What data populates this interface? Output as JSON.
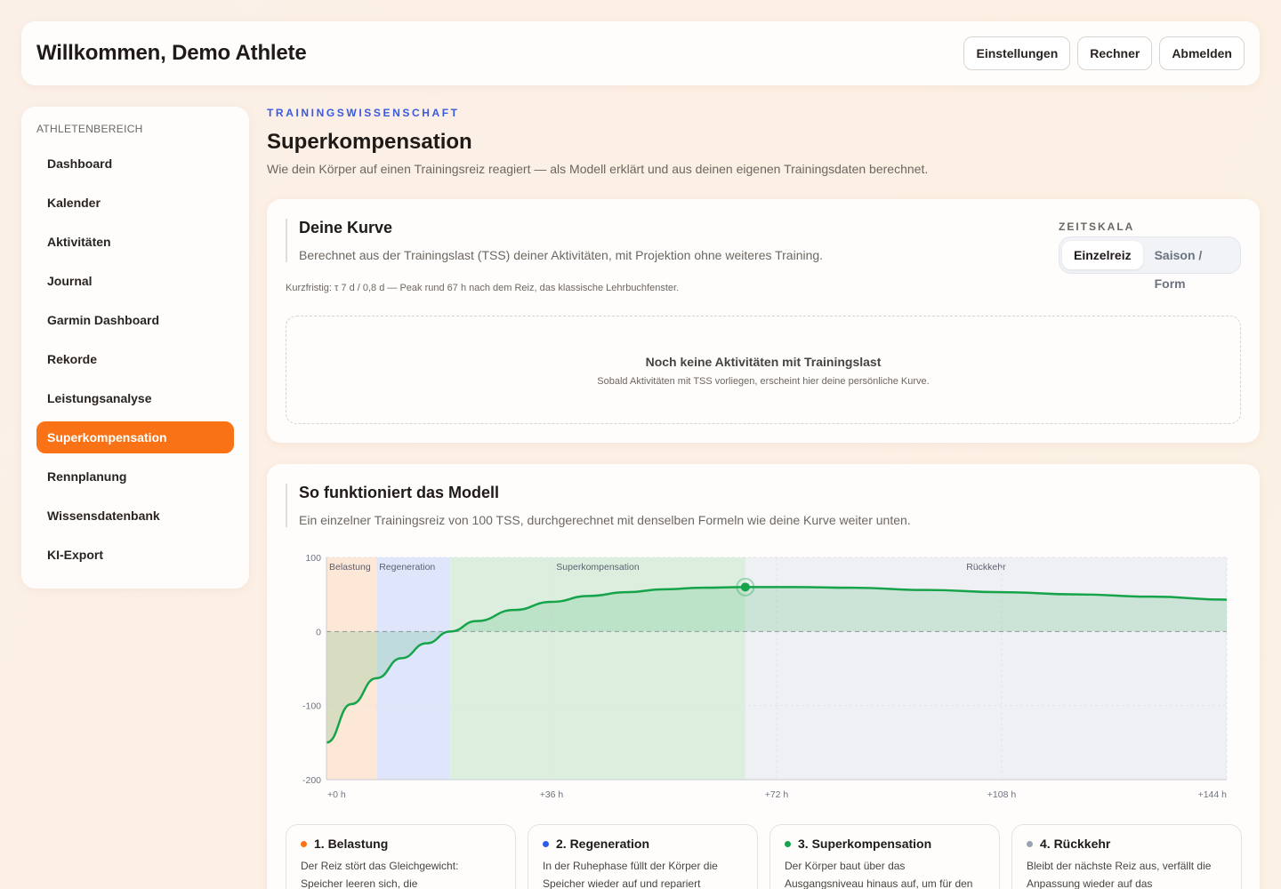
{
  "header": {
    "welcome": "Willkommen, Demo Athlete",
    "buttons": {
      "settings": "Einstellungen",
      "calculator": "Rechner",
      "logout": "Abmelden"
    }
  },
  "sidebar": {
    "heading": "ATHLETENBEREICH",
    "items": [
      {
        "label": "Dashboard"
      },
      {
        "label": "Kalender"
      },
      {
        "label": "Aktivitäten"
      },
      {
        "label": "Journal"
      },
      {
        "label": "Garmin Dashboard"
      },
      {
        "label": "Rekorde"
      },
      {
        "label": "Leistungsanalyse"
      },
      {
        "label": "Superkompensation",
        "active": true
      },
      {
        "label": "Rennplanung"
      },
      {
        "label": "Wissensdatenbank"
      },
      {
        "label": "KI-Export"
      }
    ]
  },
  "page": {
    "eyebrow": "TRAININGSWISSENSCHAFT",
    "title": "Superkompensation",
    "subtitle": "Wie dein Körper auf einen Trainingsreiz reagiert — als Modell erklärt und aus deinen eigenen Trainingsdaten berechnet."
  },
  "curve_card": {
    "title": "Deine Kurve",
    "subtitle": "Berechnet aus der Trainingslast (TSS) deiner Aktivitäten, mit Projektion ohne weiteres Training.",
    "note": "Kurzfristig: τ 7 d / 0,8 d — Peak rund 67 h nach dem Reiz, das klassische Lehrbuchfenster.",
    "scale_label": "ZEITSKALA",
    "scale_options": [
      "Einzelreiz",
      "Saison / Form"
    ],
    "scale_selected": "Einzelreiz",
    "empty_title": "Noch keine Aktivitäten mit Trainingslast",
    "empty_text": "Sobald Aktivitäten mit TSS vorliegen, erscheint hier deine persönliche Kurve."
  },
  "model_card": {
    "title": "So funktioniert das Modell",
    "subtitle": "Ein einzelner Trainingsreiz von 100 TSS, durchgerechnet mit denselben Formeln wie deine Kurve weiter unten."
  },
  "colors": {
    "accent": "#f97316",
    "eyebrow": "#3b5bdb",
    "curve": "#16a34a",
    "phase_load": "#f97316",
    "phase_regen": "#2f5bea",
    "phase_super": "#16a34a",
    "phase_return": "#9aa3b2"
  },
  "chart_data": {
    "type": "area",
    "title": "",
    "xlabel": "",
    "ylabel": "",
    "xlim": [
      0,
      144
    ],
    "ylim": [
      -200,
      100
    ],
    "x_ticks": [
      "+0 h",
      "+36 h",
      "+72 h",
      "+108 h",
      "+144 h"
    ],
    "x_tick_values": [
      0,
      36,
      72,
      108,
      144
    ],
    "y_ticks": [
      "100",
      "0",
      "-100",
      "-200"
    ],
    "y_tick_values": [
      100,
      0,
      -100,
      -200
    ],
    "phases": [
      {
        "name": "Belastung",
        "from": 0,
        "to": 8
      },
      {
        "name": "Regeneration",
        "from": 8,
        "to": 19.8
      },
      {
        "name": "Superkompensation",
        "from": 19.8,
        "to": 67
      },
      {
        "name": "Rückkehr",
        "from": 67,
        "to": 144
      }
    ],
    "series": [
      {
        "x": [
          0,
          4,
          8,
          12,
          16,
          19.8,
          24,
          30,
          36,
          42,
          48,
          54,
          60,
          67,
          75,
          84,
          96,
          108,
          120,
          132,
          144
        ],
        "values": [
          -150,
          -98,
          -63,
          -36,
          -16,
          0,
          14,
          29,
          40,
          48,
          53,
          57,
          59,
          60,
          60,
          59,
          56,
          53,
          50,
          47,
          43
        ]
      }
    ],
    "peak": {
      "x": 67,
      "y": 60
    },
    "grid": true
  },
  "phase_cards": [
    {
      "title": "1. Belastung",
      "text": "Der Reiz stört das Gleichgewicht: Speicher leeren sich, die Leistungsfähigkeit sinkt",
      "color": "#f97316"
    },
    {
      "title": "2. Regeneration",
      "text": "In der Ruhephase füllt der Körper die Speicher wieder auf und repariert Gewebe",
      "color": "#2f5bea"
    },
    {
      "title": "3. Superkompensation",
      "text": "Der Körper baut über das Ausgangsniveau hinaus auf, um für den nächsten gleichen",
      "color": "#16a34a"
    },
    {
      "title": "4. Rückkehr",
      "text": "Bleibt der nächste Reiz aus, verfällt die Anpassung wieder auf das",
      "color": "#9aa3b2"
    }
  ]
}
